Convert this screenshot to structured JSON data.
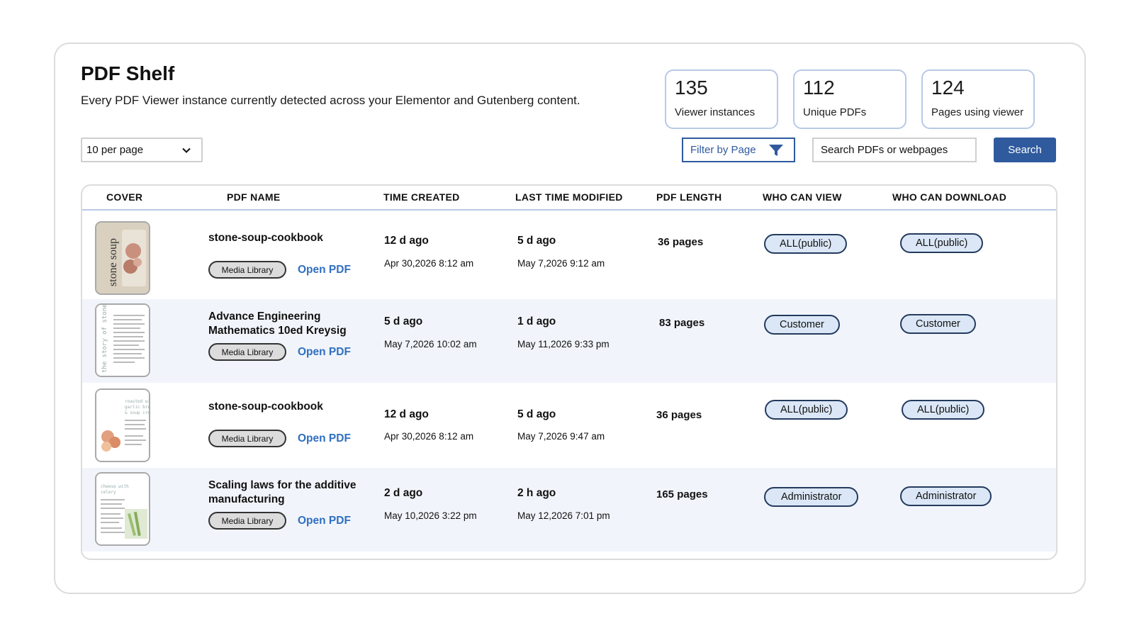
{
  "page": {
    "title": "PDF Shelf",
    "subtitle": "Every PDF Viewer instance currently detected across your Elementor and Gutenberg content."
  },
  "stats": [
    {
      "value": "135",
      "label": "Viewer instances"
    },
    {
      "value": "112",
      "label": "Unique PDFs"
    },
    {
      "value": "124",
      "label": "Pages using viewer"
    }
  ],
  "controls": {
    "per_page": "10 per page",
    "filter_label": "Filter by Page",
    "search_placeholder": "Search PDFs or webpages",
    "search_button": "Search"
  },
  "table": {
    "headers": [
      "COVER",
      "PDF NAME",
      "TIME CREATED",
      "LAST TIME MODIFIED",
      "PDF LENGTH",
      "WHO CAN VIEW",
      "WHO CAN DOWNLOAD"
    ],
    "media_library_label": "Media Library",
    "open_pdf_label": "Open PDF",
    "rows": [
      {
        "cover": "stone-soup-cover-icon",
        "name": "stone-soup-cookbook",
        "created_rel": "12 d ago",
        "created_abs": "Apr 30,2026 8:12 am",
        "modified_rel": "5 d ago",
        "modified_abs": "May 7,2026 9:12 am",
        "length": "36 pages",
        "view": "ALL(public)",
        "download": "ALL(public)"
      },
      {
        "cover": "text-page-cover-icon",
        "name": "Advance Engineering Mathematics 10ed Kreysig",
        "created_rel": "5 d ago",
        "created_abs": "May 7,2026 10:02 am",
        "modified_rel": "1 d ago",
        "modified_abs": "May 11,2026 9:33 pm",
        "length": "83 pages",
        "view": "Customer",
        "download": "Customer"
      },
      {
        "cover": "recipe-page-cover-icon",
        "name": "stone-soup-cookbook",
        "created_rel": "12 d ago",
        "created_abs": "Apr 30,2026 8:12 am",
        "modified_rel": "5 d ago",
        "modified_abs": "May 7,2026 9:47 am",
        "length": "36 pages",
        "view": "ALL(public)",
        "download": "ALL(public)"
      },
      {
        "cover": "celery-page-cover-icon",
        "name": "Scaling laws for the additive manufacturing",
        "created_rel": "2 d ago",
        "created_abs": "May 10,2026 3:22 pm",
        "modified_rel": "2 h ago",
        "modified_abs": "May 12,2026 7:01 pm",
        "length": "165 pages",
        "view": "Administrator",
        "download": "Administrator"
      }
    ]
  },
  "colors": {
    "accent": "#2f5a9e",
    "link": "#2f6fc1",
    "pill_bg": "#dbe7f6",
    "alt_row": "#f1f5fb"
  }
}
